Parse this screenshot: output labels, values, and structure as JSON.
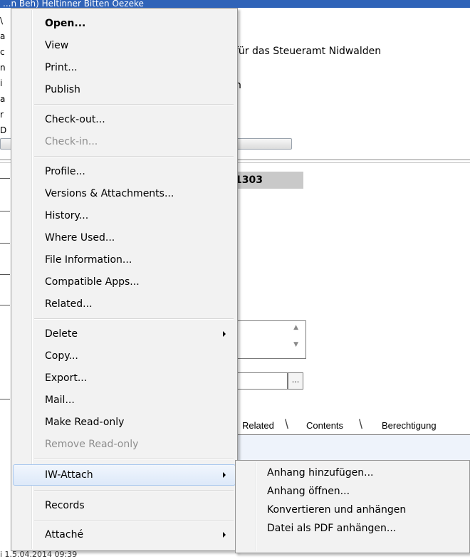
{
  "window": {
    "title": "...n Beh) Heltinner Bitten Oezeke",
    "body_lines": {
      "line1": "für das Steueramt Nidwalden",
      "line2": "n"
    },
    "left_edge_chars": [
      "\\",
      "a",
      "c",
      "n",
      "i",
      "a",
      "r",
      "D"
    ],
    "record_number": "1303",
    "dots_button": "...",
    "tabs": [
      "Related",
      "Contents",
      "Berechtigung"
    ],
    "footer_text": "i 1.5.04.2014 09:39"
  },
  "context_menu": {
    "groups": [
      [
        {
          "label": "Open...",
          "bold": true
        },
        {
          "label": "View"
        },
        {
          "label": "Print..."
        },
        {
          "label": "Publish"
        }
      ],
      [
        {
          "label": "Check-out..."
        },
        {
          "label": "Check-in...",
          "disabled": true
        }
      ],
      [
        {
          "label": "Profile..."
        },
        {
          "label": "Versions & Attachments..."
        },
        {
          "label": "History..."
        },
        {
          "label": "Where Used..."
        },
        {
          "label": "File Information..."
        },
        {
          "label": "Compatible Apps..."
        },
        {
          "label": "Related..."
        }
      ],
      [
        {
          "label": "Delete",
          "submenu": true
        },
        {
          "label": "Copy..."
        },
        {
          "label": "Export..."
        },
        {
          "label": "Mail..."
        },
        {
          "label": "Make Read-only"
        },
        {
          "label": "Remove Read-only",
          "disabled": true
        }
      ],
      [
        {
          "label": "IW-Attach",
          "submenu": true,
          "highlighted": true
        }
      ],
      [
        {
          "label": "Records"
        }
      ],
      [
        {
          "label": "Attaché",
          "submenu": true
        }
      ]
    ]
  },
  "submenu": {
    "parent": "IW-Attach",
    "items": [
      {
        "label": "Anhang hinzufügen..."
      },
      {
        "label": "Anhang öffnen..."
      },
      {
        "label": "Konvertieren und anhängen"
      },
      {
        "label": "Datei als PDF anhängen..."
      }
    ]
  }
}
